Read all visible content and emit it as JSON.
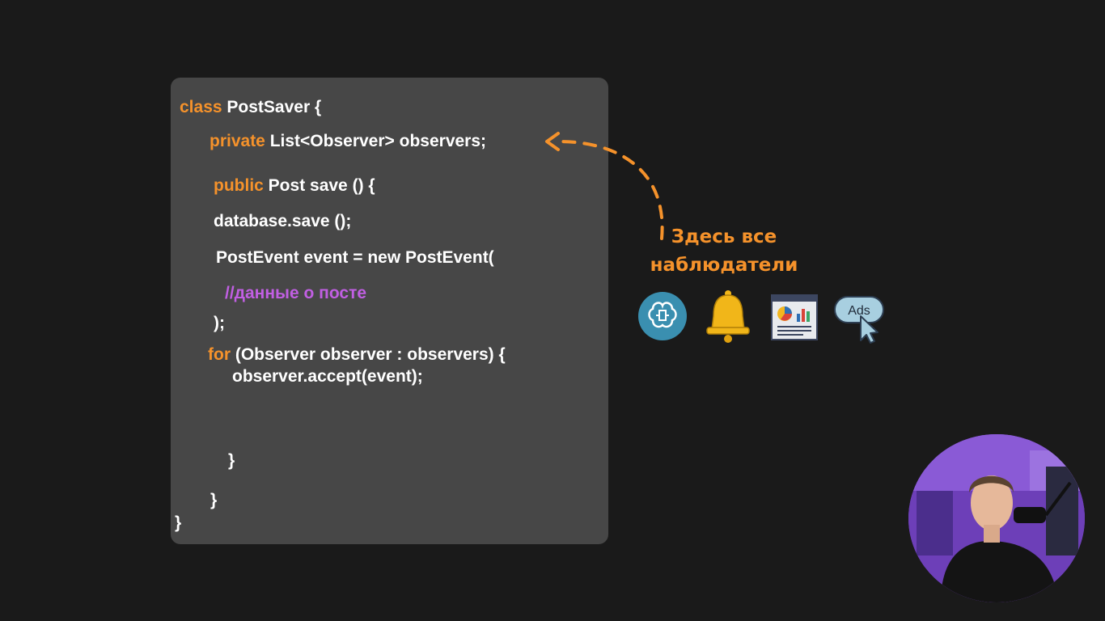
{
  "code": {
    "line1_kw": "class",
    "line1_rest": " PostSaver {",
    "line2_kw": "private",
    "line2_rest": " List<Observer> observers;",
    "line3_kw": "public",
    "line3_rest": " Post save () {",
    "line4": "database.save ();",
    "line5": "PostEvent event = new PostEvent(",
    "line6_comment": "//данные о посте",
    "line7": ");",
    "line8_kw": "for",
    "line8_rest": " (Observer observer : observers) {",
    "line9": "observer.accept(event);",
    "line10": "}",
    "line11": "}",
    "line12": "}"
  },
  "annotation": {
    "caption_line1": "Здесь все",
    "caption_line2": "наблюдатели"
  },
  "icons": [
    {
      "name": "ai-brain-icon"
    },
    {
      "name": "notification-bell-icon"
    },
    {
      "name": "analytics-report-icon"
    },
    {
      "name": "ads-click-icon",
      "label": "Ads"
    }
  ],
  "colors": {
    "background": "#1a1a1a",
    "panel": "#474747",
    "keyword": "#f5922b",
    "comment": "#c15fe3",
    "text": "#ffffff",
    "accent_orange": "#f5922b"
  }
}
